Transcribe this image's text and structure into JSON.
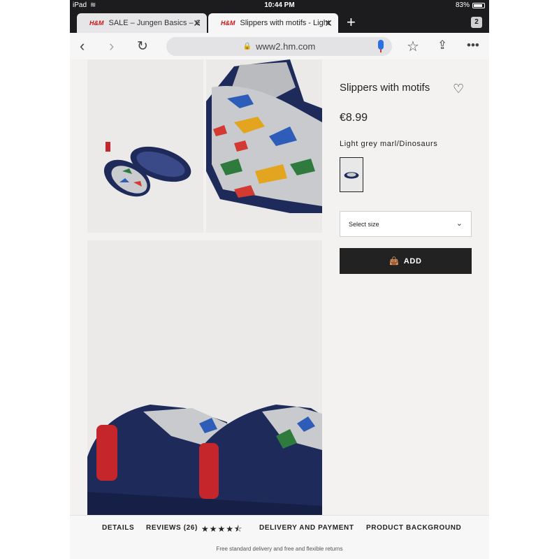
{
  "status": {
    "device": "iPad",
    "time": "10:44 PM",
    "battery": "83%"
  },
  "tabs": [
    {
      "logo": "H&M",
      "title": "SALE – Jungen Basics – Gr",
      "active": false
    },
    {
      "logo": "H&M",
      "title": "Slippers with motifs - Light",
      "active": true
    }
  ],
  "tab_count": "2",
  "url": "www2.hm.com",
  "product": {
    "name": "Slippers with motifs",
    "price": "€8.99",
    "color": "Light grey marl/Dinosaurs",
    "size_placeholder": "Select size",
    "add_label": "ADD"
  },
  "bottom_nav": {
    "details": "DETAILS",
    "reviews": "REVIEWS (26)",
    "rating": 4.5,
    "delivery": "DELIVERY AND PAYMENT",
    "background": "PRODUCT BACKGROUND"
  },
  "delivery_note": "Free standard delivery and free and flexible returns",
  "colors": {
    "brand": "#c4171c",
    "dark": "#222222",
    "navy": "#1e2a5a"
  }
}
